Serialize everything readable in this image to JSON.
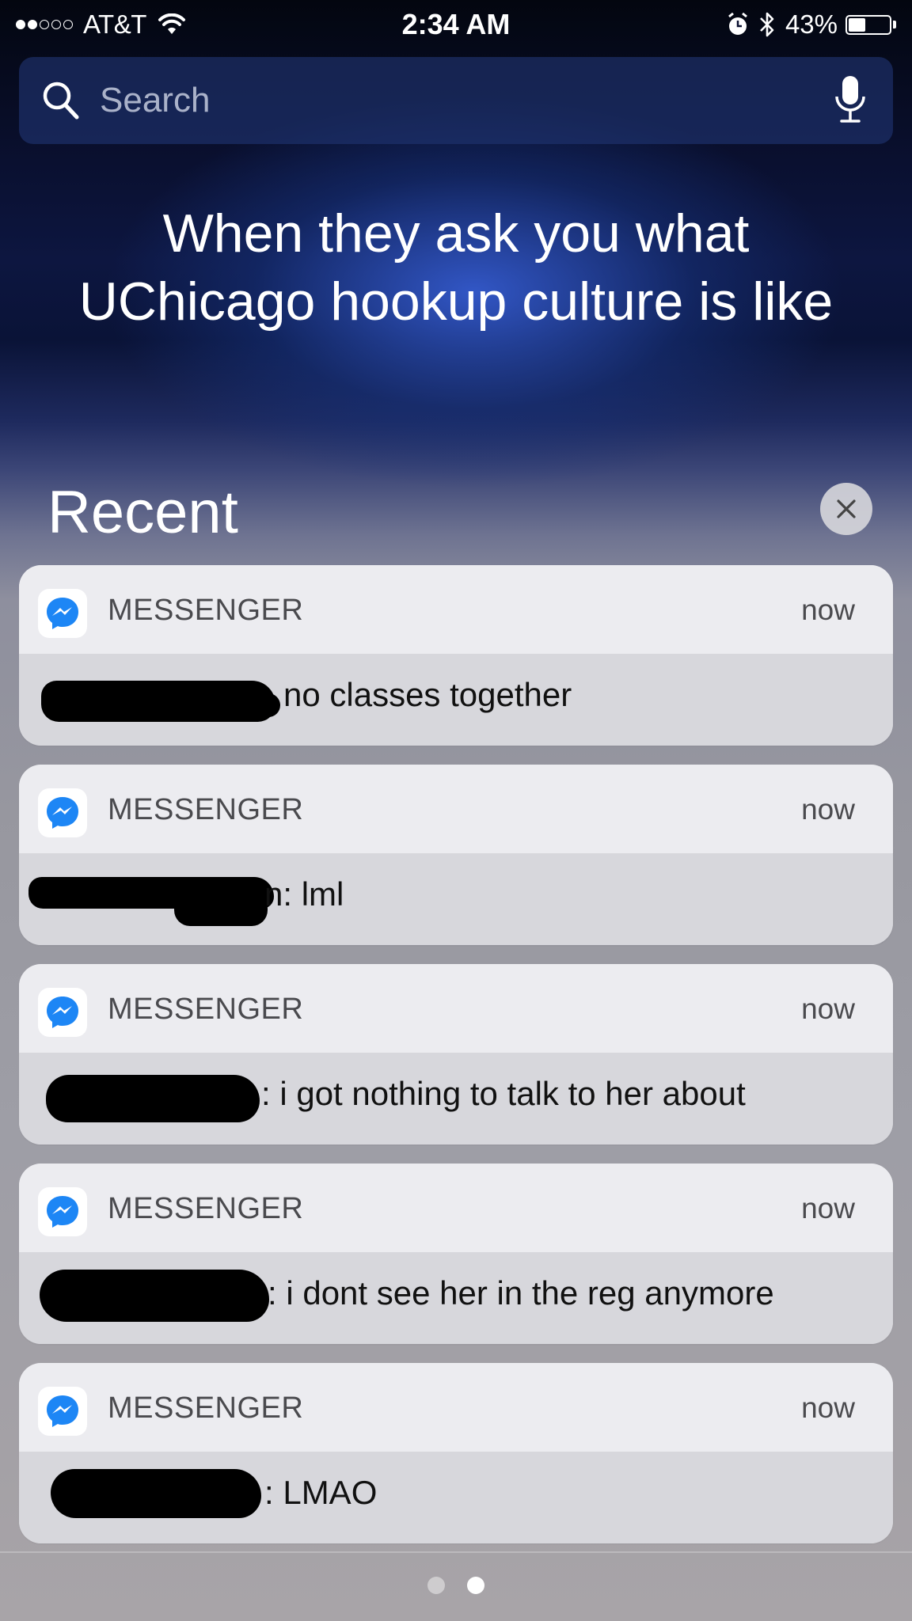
{
  "status_bar": {
    "carrier": "AT&T",
    "time": "2:34 AM",
    "battery": "43%",
    "battery_level": 0.43,
    "signal_bars_filled": 2,
    "signal_bars_total": 5,
    "icons": [
      "wifi-icon",
      "alarm-icon",
      "bluetooth-icon",
      "battery-icon"
    ]
  },
  "search": {
    "placeholder": "Search",
    "icons": [
      "search-icon",
      "microphone-icon"
    ]
  },
  "caption": {
    "line1": "When they ask you what",
    "line2": "UChicago hookup culture is like"
  },
  "recent": {
    "title": "Recent",
    "clear_icon": "close-icon"
  },
  "notifications": [
    {
      "app": "MESSENGER",
      "time": "now",
      "message": "no classes together"
    },
    {
      "app": "MESSENGER",
      "time": "now",
      "message": "n: lml"
    },
    {
      "app": "MESSENGER",
      "time": "now",
      "message": ": i got nothing to talk to her about"
    },
    {
      "app": "MESSENGER",
      "time": "now",
      "message": ": i dont see her in the reg anymore"
    },
    {
      "app": "MESSENGER",
      "time": "now",
      "message": ": LMAO"
    }
  ],
  "page_indicator": {
    "count": 2,
    "active": 2
  },
  "colors": {
    "messenger_blue": "#1d86f5",
    "card_header": "#ececf0",
    "card_body": "#d6d6dc"
  }
}
